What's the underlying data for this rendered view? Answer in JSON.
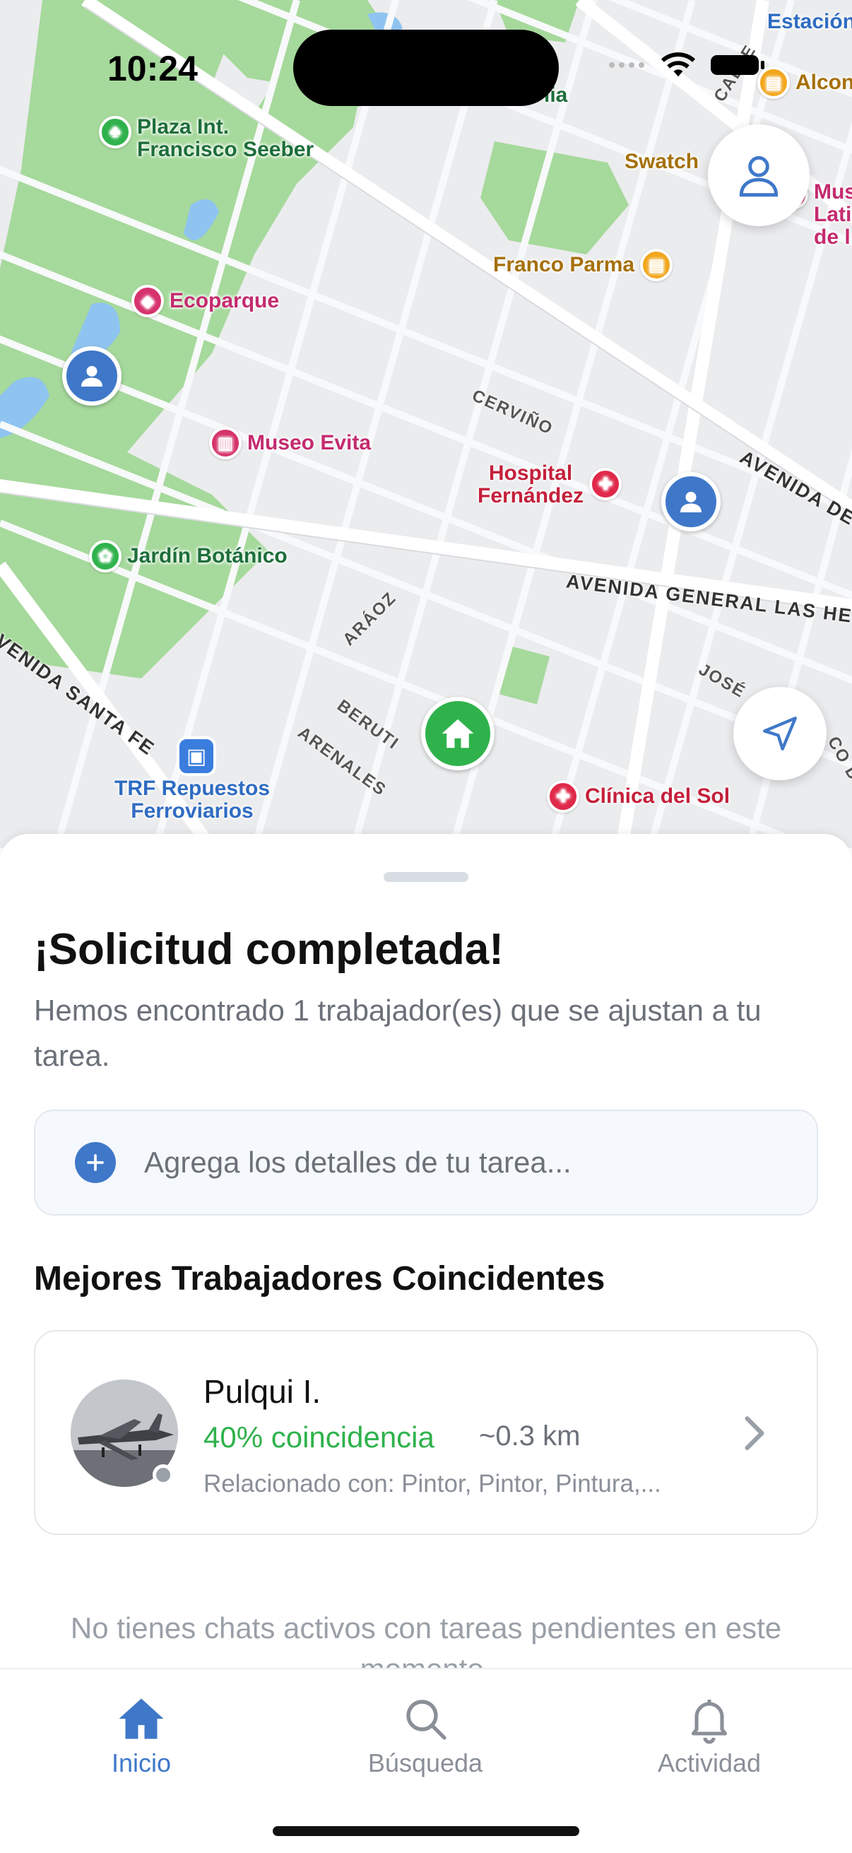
{
  "status_bar": {
    "time": "10:24"
  },
  "map": {
    "pois": {
      "plaza": "Plaza Int.\nFrancisco Seeber",
      "ecoparque": "Ecoparque",
      "museo_evita": "Museo Evita",
      "hospital": "Hospital\nFernández",
      "jardin": "Jardín Botánico",
      "trf": "TRF Repuestos\nFerroviarios",
      "clinica": "Clínica del Sol",
      "franco": "Franco Parma",
      "swatch": "Swatch",
      "estacion": "Estación",
      "alcon": "Alcon",
      "mus": "Mus\nLati\nde l",
      "lia": "lia"
    },
    "streets": {
      "cervino": "CERVIÑO",
      "avenida_del": "AVENIDA DEL",
      "av_las_heras": "AVENIDA GENERAL LAS HE",
      "av_santa_fe": "AVENIDA SANTA FE",
      "araoz": "ARÁOZ",
      "beruti": "BERUTI",
      "arenales": "ARENALES",
      "jose": "JOSÉ",
      "calle": "CALLE",
      "co_d": "CO D"
    }
  },
  "sheet": {
    "title": "¡Solicitud completada!",
    "subtitle": "Hemos encontrado 1 trabajador(es) que se ajustan a tu tarea.",
    "details_placeholder": "Agrega los detalles de tu tarea...",
    "section_title": "Mejores Trabajadores Coincidentes",
    "worker": {
      "name": "Pulqui I.",
      "match": "40% coincidencia",
      "distance": "~0.3 km",
      "related": "Relacionado con: Pintor, Pintor, Pintura,..."
    },
    "no_chats": "No tienes chats activos con tareas pendientes en este momento."
  },
  "tabbar": {
    "tabs": [
      {
        "label": "Inicio",
        "icon": "home-icon",
        "active": true
      },
      {
        "label": "Búsqueda",
        "icon": "search-icon",
        "active": false
      },
      {
        "label": "Actividad",
        "icon": "bell-icon",
        "active": false
      }
    ]
  },
  "colors": {
    "accent": "#3f78c9",
    "match_green": "#2fb24c",
    "park": "#a4d89a",
    "poi_pink": "#d6336c",
    "poi_red": "#e0294a",
    "poi_orange": "#f2a61c",
    "transit": "#3a7dde"
  }
}
